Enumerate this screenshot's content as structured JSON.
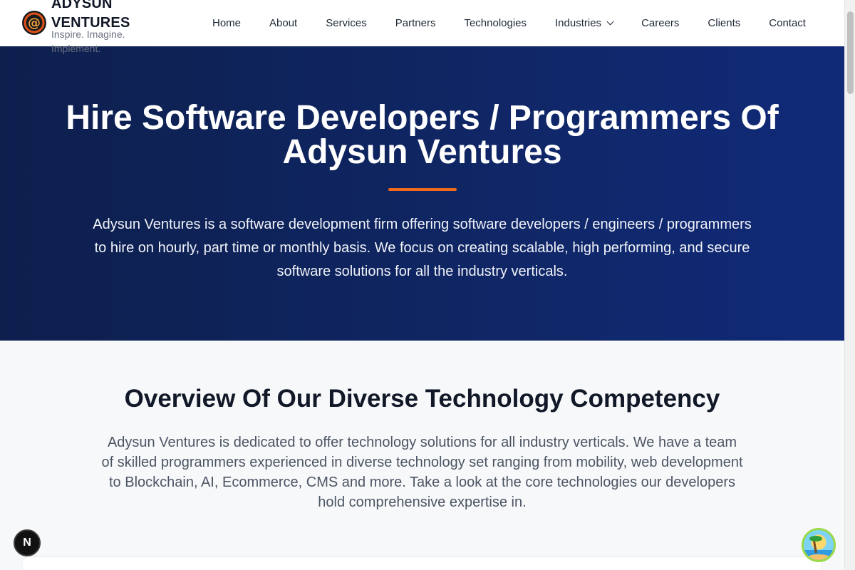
{
  "brand": {
    "name": "ADYSUN VENTURES",
    "tagline": "Inspire. Imagine. Implement.",
    "logo_icon": "at-sign-logo-icon",
    "logo_glyph": "@"
  },
  "nav": {
    "items": [
      {
        "label": "Home"
      },
      {
        "label": "About"
      },
      {
        "label": "Services"
      },
      {
        "label": "Partners"
      },
      {
        "label": "Technologies"
      },
      {
        "label": "Industries",
        "has_dropdown": true
      },
      {
        "label": "Careers"
      },
      {
        "label": "Clients"
      },
      {
        "label": "Contact"
      }
    ]
  },
  "hero": {
    "title": "Hire Software Developers / Programmers Of Adysun Ventures",
    "text": "Adysun Ventures is a software development firm offering software developers / engineers / programmers to hire on hourly, part time or monthly basis. We focus on creating scalable, high performing, and secure software solutions for all the industry verticals."
  },
  "overview": {
    "title": "Overview Of Our Diverse Technology Competency",
    "text": "Adysun Ventures is dedicated to offer technology solutions for all industry verticals. We have a team of skilled programmers experienced in diverse technology set ranging from mobility, web development to Blockchain, AI, Ecommerce, CMS and more. Take a look at the core technologies our developers hold comprehensive expertise in."
  },
  "floating": {
    "dev_badge_label": "N",
    "chat_icon": "beach-chat-icon"
  },
  "colors": {
    "hero_bg": "#0f2560",
    "accent": "#f06a1d",
    "heading": "#111827",
    "body_text": "#4b5563"
  }
}
